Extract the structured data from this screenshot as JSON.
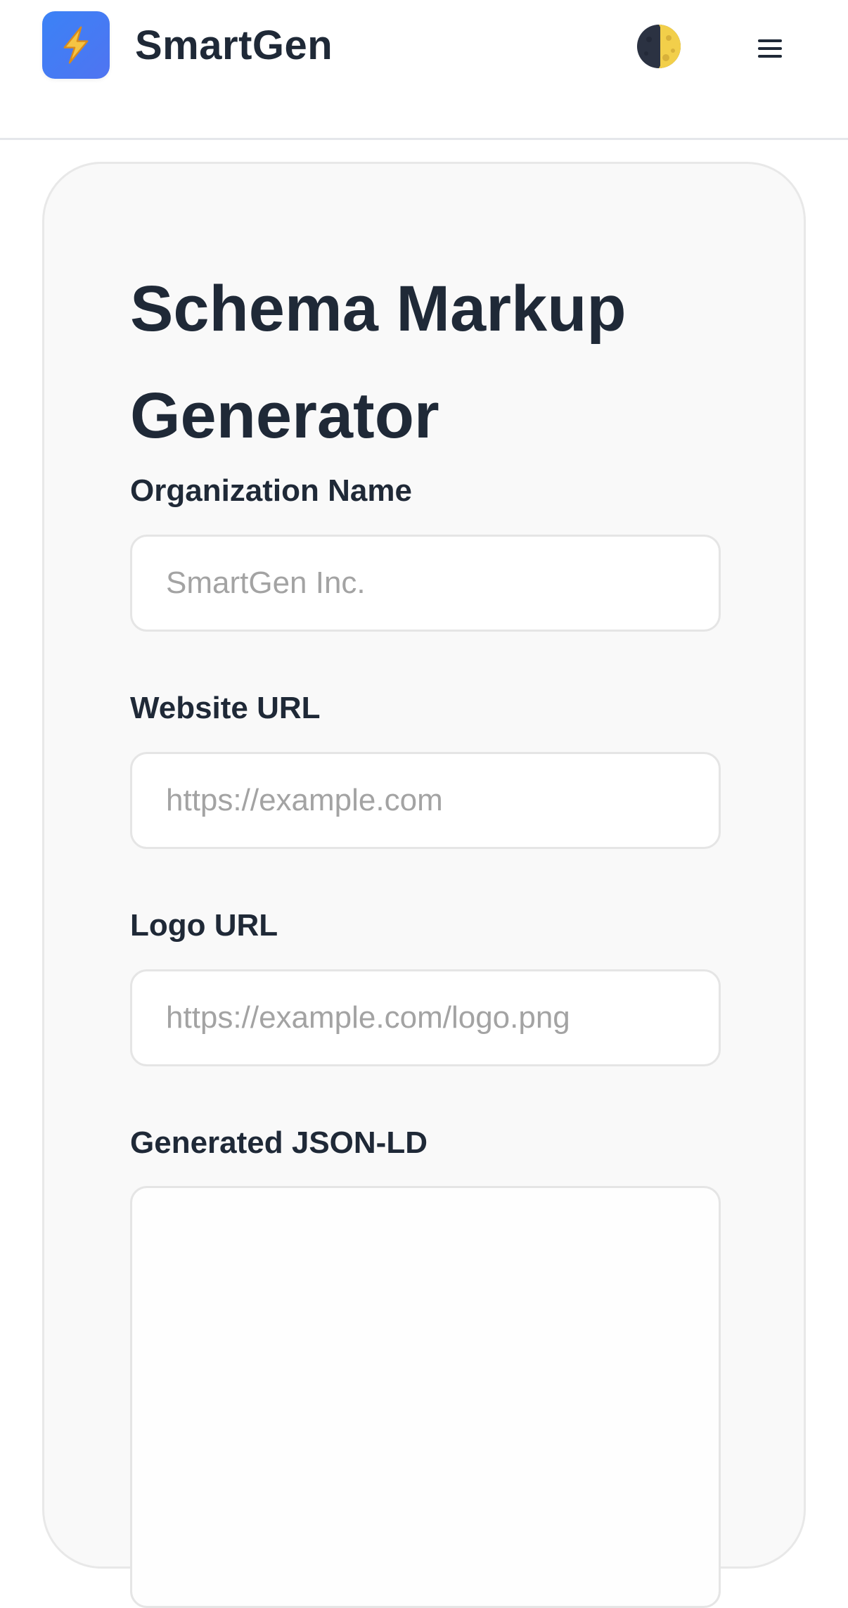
{
  "header": {
    "brand": "SmartGen",
    "logo_icon": "lightning-bolt-icon",
    "theme_icon": "moon-icon",
    "menu_icon": "hamburger-menu-icon"
  },
  "form": {
    "title": "Schema Markup Generator",
    "org_name": {
      "label": "Organization Name",
      "value": "",
      "placeholder": "SmartGen Inc."
    },
    "website_url": {
      "label": "Website URL",
      "value": "",
      "placeholder": "https://example.com"
    },
    "logo_url": {
      "label": "Logo URL",
      "value": "",
      "placeholder": "https://example.com/logo.png"
    },
    "json_output": {
      "label": "Generated JSON-LD",
      "value": ""
    }
  },
  "colors": {
    "accent": "#3b82f6",
    "text": "#1f2937",
    "placeholder": "#a3a3a3",
    "card_bg": "#f9f9f9",
    "border": "#e5e5e5"
  }
}
